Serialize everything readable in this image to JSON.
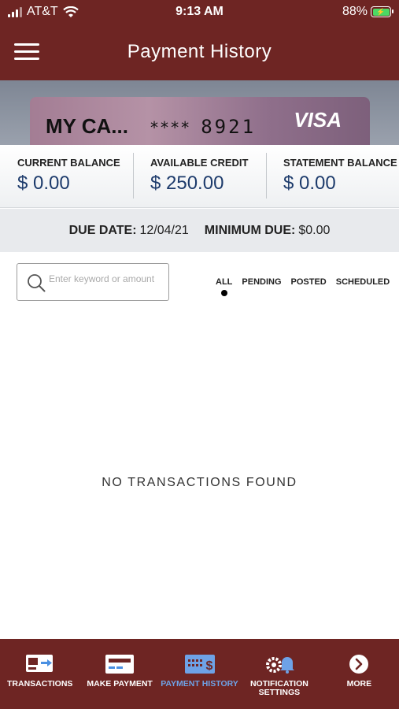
{
  "status_bar": {
    "carrier": "AT&T",
    "time": "9:13 AM",
    "battery": "88%"
  },
  "header": {
    "title": "Payment History"
  },
  "card": {
    "name": "MY CA...",
    "masked_prefix": "****",
    "last_four": "8921",
    "network": "VISA"
  },
  "balances": [
    {
      "label": "CURRENT BALANCE",
      "value": "$ 0.00"
    },
    {
      "label": "AVAILABLE CREDIT",
      "value": "$ 250.00"
    },
    {
      "label": "STATEMENT BALANCE",
      "value": "$ 0.00"
    }
  ],
  "due": {
    "due_date_label": "DUE DATE:",
    "due_date": "12/04/21",
    "minimum_due_label": "MINIMUM DUE:",
    "minimum_due": "$0.00"
  },
  "search": {
    "placeholder": "Enter keyword or amount"
  },
  "filters": {
    "all": "ALL",
    "pending": "PENDING",
    "posted": "POSTED",
    "scheduled": "SCHEDULED",
    "selected": "ALL"
  },
  "empty_state": "NO TRANSACTIONS FOUND",
  "bottom_nav": {
    "transactions": "TRANSACTIONS",
    "make_payment": "MAKE PAYMENT",
    "payment_history": "PAYMENT HISTORY",
    "notification_settings": "NOTIFICATION SETTINGS",
    "more": "MORE",
    "active": "PAYMENT HISTORY",
    "active_color": "#6ea2e6"
  },
  "colors": {
    "brand": "#6e2523",
    "balance_value": "#1c3a6b"
  }
}
